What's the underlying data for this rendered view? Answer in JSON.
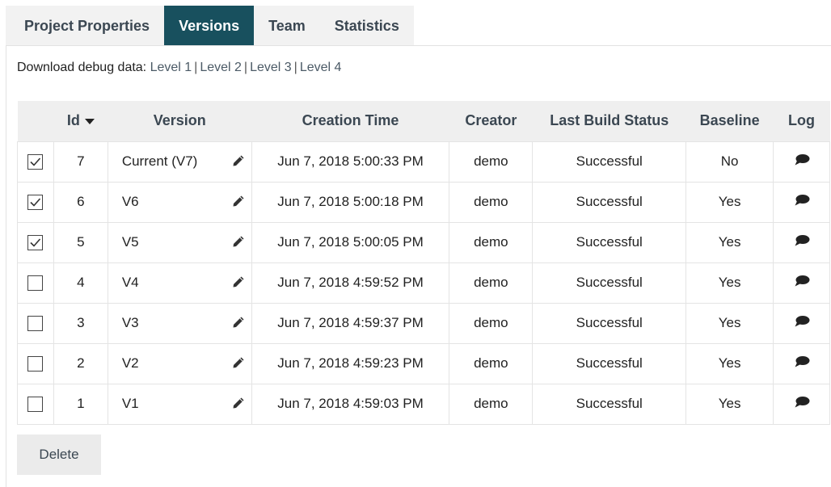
{
  "tabs": [
    {
      "label": "Project Properties",
      "active": false
    },
    {
      "label": "Versions",
      "active": true
    },
    {
      "label": "Team",
      "active": false
    },
    {
      "label": "Statistics",
      "active": false
    }
  ],
  "debug": {
    "label": "Download debug data:",
    "levels": [
      "Level 1",
      "Level 2",
      "Level 3",
      "Level 4"
    ],
    "separator": "|"
  },
  "table": {
    "headers": {
      "id": "Id",
      "version": "Version",
      "creation_time": "Creation Time",
      "creator": "Creator",
      "last_build_status": "Last Build Status",
      "baseline": "Baseline",
      "log": "Log"
    },
    "sort_icon": "caret-down-icon",
    "rows": [
      {
        "checked": true,
        "id": "7",
        "version": "Current (V7)",
        "time": "Jun 7, 2018 5:00:33 PM",
        "creator": "demo",
        "status": "Successful",
        "baseline": "No"
      },
      {
        "checked": true,
        "id": "6",
        "version": "V6",
        "time": "Jun 7, 2018 5:00:18 PM",
        "creator": "demo",
        "status": "Successful",
        "baseline": "Yes"
      },
      {
        "checked": true,
        "id": "5",
        "version": "V5",
        "time": "Jun 7, 2018 5:00:05 PM",
        "creator": "demo",
        "status": "Successful",
        "baseline": "Yes"
      },
      {
        "checked": false,
        "id": "4",
        "version": "V4",
        "time": "Jun 7, 2018 4:59:52 PM",
        "creator": "demo",
        "status": "Successful",
        "baseline": "Yes"
      },
      {
        "checked": false,
        "id": "3",
        "version": "V3",
        "time": "Jun 7, 2018 4:59:37 PM",
        "creator": "demo",
        "status": "Successful",
        "baseline": "Yes"
      },
      {
        "checked": false,
        "id": "2",
        "version": "V2",
        "time": "Jun 7, 2018 4:59:23 PM",
        "creator": "demo",
        "status": "Successful",
        "baseline": "Yes"
      },
      {
        "checked": false,
        "id": "1",
        "version": "V1",
        "time": "Jun 7, 2018 4:59:03 PM",
        "creator": "demo",
        "status": "Successful",
        "baseline": "Yes"
      }
    ]
  },
  "delete_label": "Delete",
  "colors": {
    "active_tab": "#18505e",
    "tab_text": "#3b4752",
    "header_bg": "#efefef"
  }
}
